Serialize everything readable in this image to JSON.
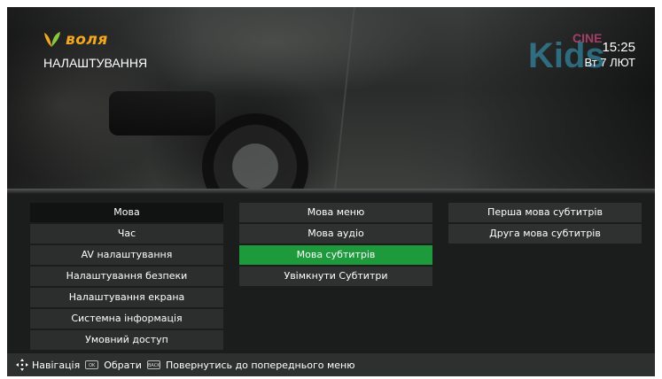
{
  "brand": {
    "name": "воля",
    "accent": "#f3a81d"
  },
  "header": {
    "title": "НАЛАШТУВАННЯ"
  },
  "channel_logo": {
    "text_main": "Kids",
    "text_small": "CINE",
    "colors": {
      "kids": "#3aa6c9",
      "cine": "#e84e8a"
    }
  },
  "clock": {
    "time": "15:25",
    "date": "Вт 7 ЛЮТ"
  },
  "menu": {
    "categories": [
      {
        "label": "Мова",
        "active": true
      },
      {
        "label": "Час"
      },
      {
        "label": "AV налаштування"
      },
      {
        "label": "Налаштування безпеки"
      },
      {
        "label": "Налаштування екрана"
      },
      {
        "label": "Системна інформація"
      },
      {
        "label": "Умовний доступ"
      }
    ],
    "language_options": [
      {
        "label": "Мова меню"
      },
      {
        "label": "Мова аудіо"
      },
      {
        "label": "Мова субтитрів",
        "selected": true
      },
      {
        "label": "Увімкнути Субтитри"
      }
    ],
    "subtitle_options": [
      {
        "label": "Перша мова субтитрів"
      },
      {
        "label": "Друга мова субтитрів"
      }
    ],
    "highlight_color": "#1d9a3c"
  },
  "footer": {
    "nav_icon": "dpad-arrows-icon",
    "nav_label": "Навігація",
    "ok_key": "OK",
    "ok_label": "Обрати",
    "back_key": "BACK",
    "back_label": "Повернутись до попереднього меню"
  }
}
